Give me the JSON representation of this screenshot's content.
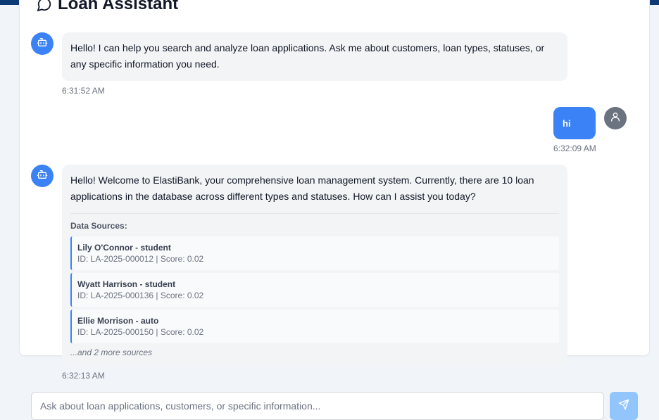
{
  "header": {
    "title": "Loan Assistant",
    "icon": "chat-bubble-icon"
  },
  "messages": [
    {
      "role": "assistant",
      "text": "Hello! I can help you search and analyze loan applications. Ask me about customers, loan types, statuses, or any specific information you need.",
      "time": "6:31:52 AM"
    },
    {
      "role": "user",
      "text": "hi",
      "time": "6:32:09 AM"
    },
    {
      "role": "assistant",
      "text": "Hello! Welcome to ElastiBank, your comprehensive loan management system. Currently, there are 10 loan applications in the database across different types and statuses. How can I assist you today?",
      "time": "6:32:13 AM",
      "sources_title": "Data Sources:",
      "sources": [
        {
          "name": "Lily O'Connor - student",
          "meta": "ID: LA-2025-000012 | Score: 0.02"
        },
        {
          "name": "Wyatt Harrison - student",
          "meta": "ID: LA-2025-000136 | Score: 0.02"
        },
        {
          "name": "Ellie Morrison - auto",
          "meta": "ID: LA-2025-000150 | Score: 0.02"
        }
      ],
      "more_sources": "...and 2 more sources"
    }
  ],
  "composer": {
    "placeholder": "Ask about loan applications, customers, or specific information...",
    "value": "",
    "send_icon": "send-icon"
  },
  "colors": {
    "accent": "#3b82f6",
    "topbar": "#0b3a75",
    "user_avatar": "#6b7280",
    "send_disabled": "#93c5fd"
  }
}
